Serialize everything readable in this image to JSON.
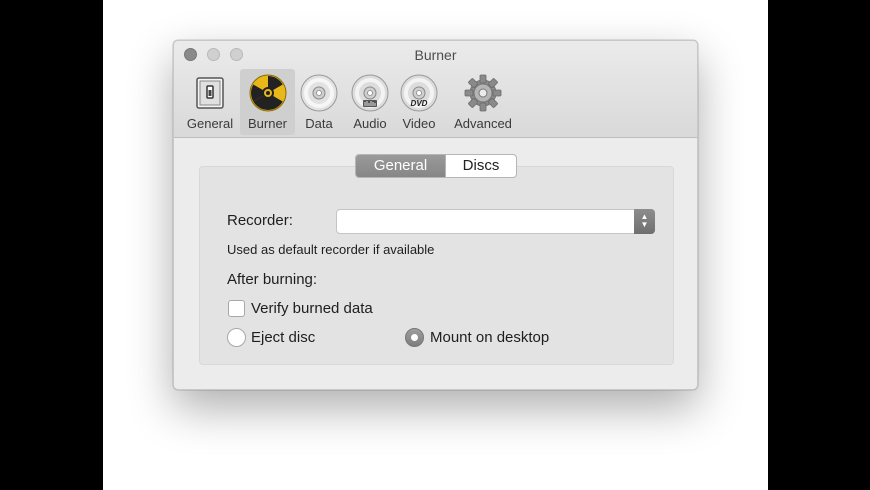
{
  "window": {
    "title": "Burner"
  },
  "toolbar": {
    "items": [
      {
        "label": "General",
        "icon": "switch-icon",
        "selected": false
      },
      {
        "label": "Burner",
        "icon": "radiation-icon",
        "selected": true
      },
      {
        "label": "Data",
        "icon": "cd-icon",
        "selected": false
      },
      {
        "label": "Audio",
        "icon": "audio-cd-icon",
        "selected": false
      },
      {
        "label": "Video",
        "icon": "dvd-icon",
        "selected": false
      },
      {
        "label": "Advanced",
        "icon": "gear-icon",
        "selected": false
      }
    ],
    "dvd_text": "DVD"
  },
  "tabs": {
    "general": "General",
    "discs": "Discs",
    "selected": "General"
  },
  "form": {
    "recorder_label": "Recorder:",
    "recorder_value": "",
    "recorder_hint": "Used as default recorder if available",
    "after_burning_label": "After burning:",
    "verify_label": "Verify burned data",
    "verify_checked": false,
    "eject_label": "Eject disc",
    "mount_label": "Mount on desktop",
    "selected_option": "Mount on desktop"
  },
  "colors": {
    "selected_tab": "#8f8f8f",
    "toolbar_selected": "#cfcfcf"
  }
}
